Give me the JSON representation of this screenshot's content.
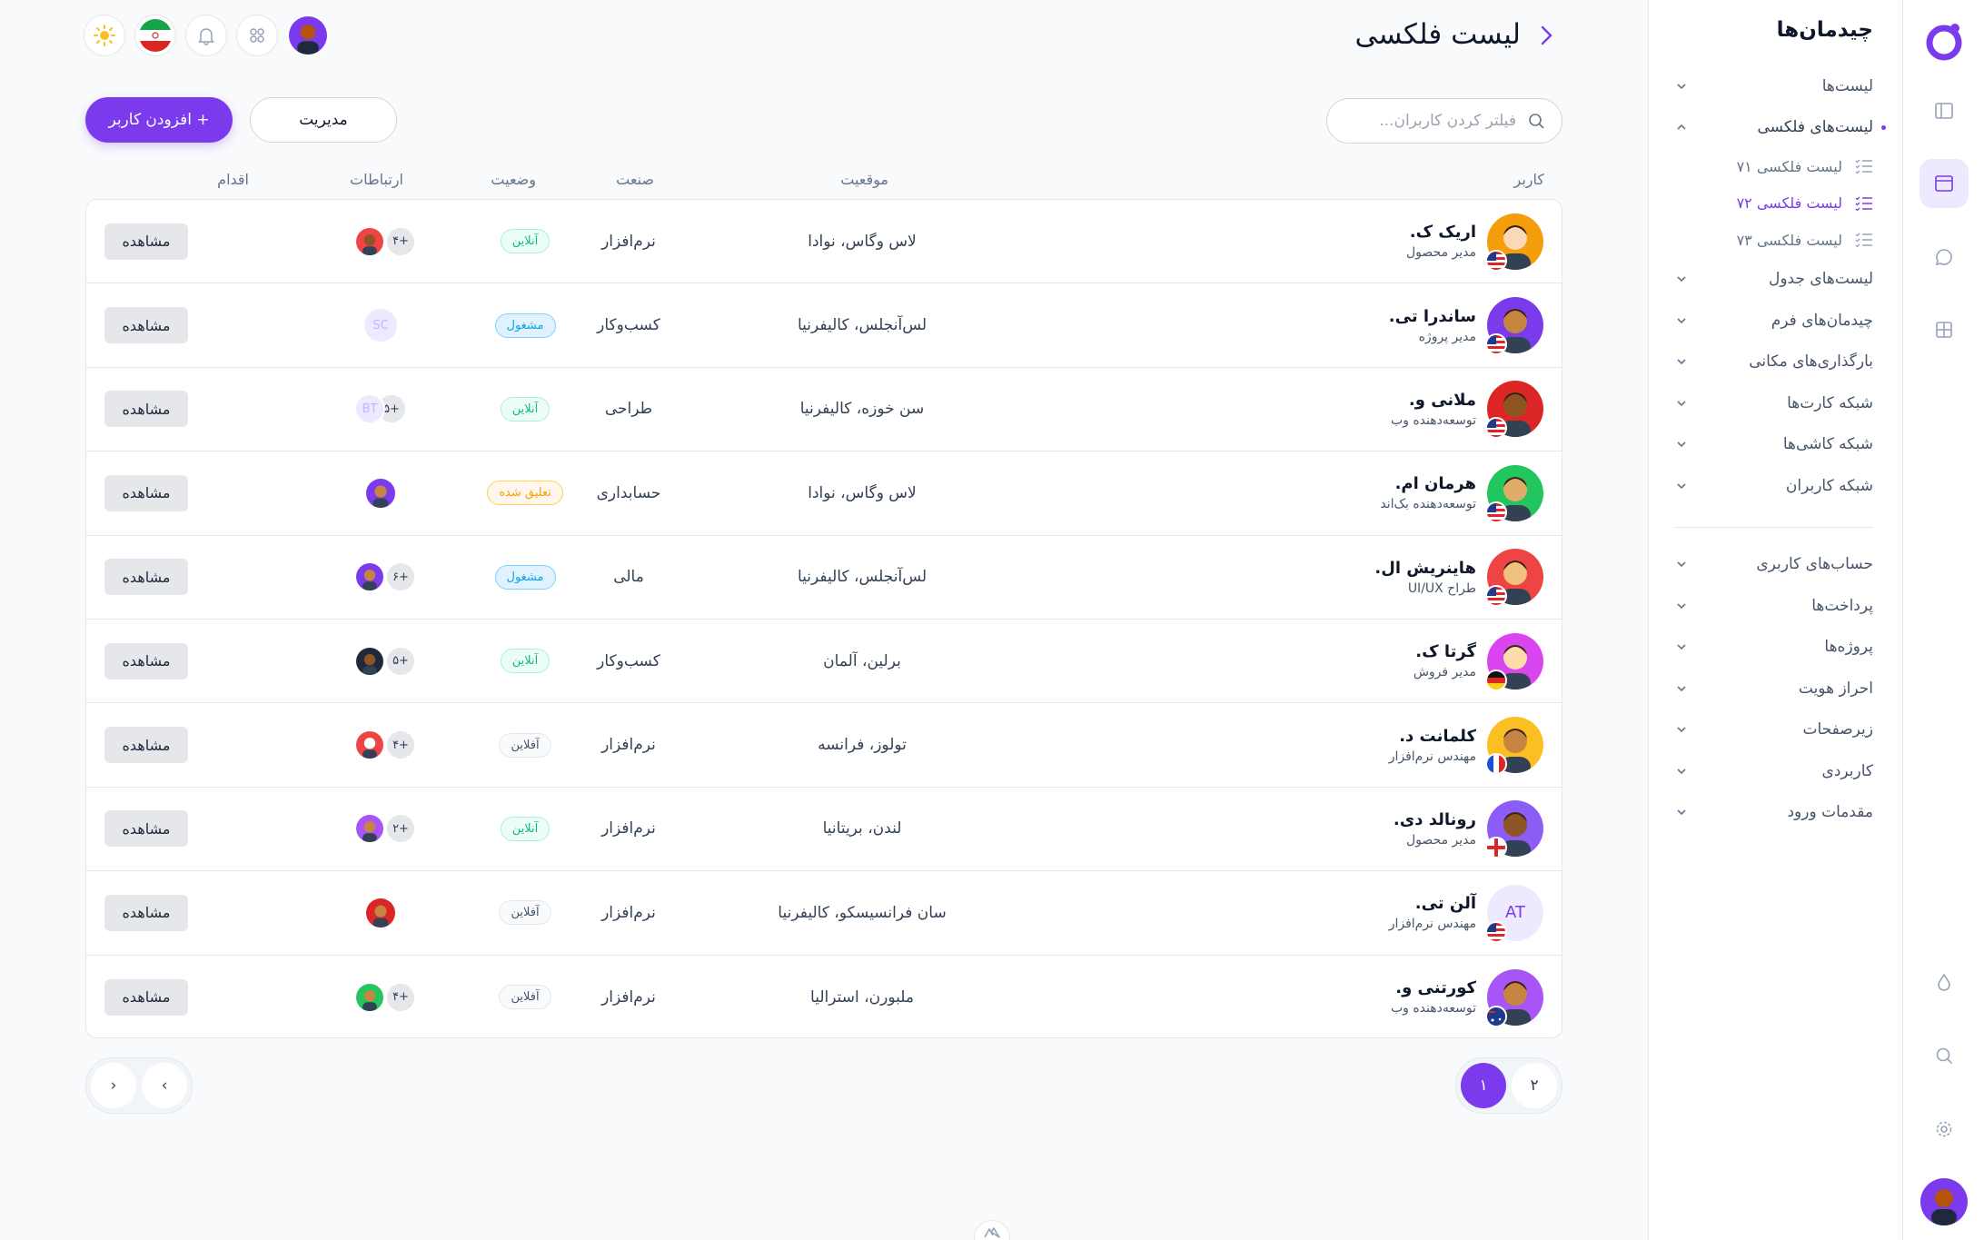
{
  "sidebar": {
    "title": "چیدمان‌ها",
    "items": [
      {
        "label": "لیست‌ها"
      },
      {
        "label": "لیست‌های فلکسی"
      },
      {
        "label": "لیست‌های جدول"
      },
      {
        "label": "چیدمان‌های فرم"
      },
      {
        "label": "بارگذاری‌های مکانی"
      },
      {
        "label": "شبکه کارت‌ها"
      },
      {
        "label": "شبکه کاشی‌ها"
      },
      {
        "label": "شبکه کاربران"
      },
      {
        "label": "حساب‌های کاربری"
      },
      {
        "label": "پرداخت‌ها"
      },
      {
        "label": "پروژه‌ها"
      },
      {
        "label": "احراز هویت"
      },
      {
        "label": "زیرصفحات"
      },
      {
        "label": "کاربردی"
      },
      {
        "label": "مقدمات ورود"
      }
    ],
    "subitems": [
      {
        "label": "لیست فلکسی ۷۱"
      },
      {
        "label": "لیست فلکسی ۷۲"
      },
      {
        "label": "لیست فلکسی ۷۳"
      }
    ]
  },
  "header": {
    "title": "لیست فلکسی"
  },
  "toolbar": {
    "search_placeholder": "فیلتر کردن کاربران...",
    "manage_label": "مدیریت",
    "add_label": "+ افزودن کاربر"
  },
  "columns": {
    "user": "کاربر",
    "location": "موقعیت",
    "industry": "صنعت",
    "status": "وضعیت",
    "relations": "ارتباطات",
    "action": "اقدام"
  },
  "rows": [
    {
      "name": "اریک ک.",
      "role": "مدیر محصول",
      "location": "لاس وگاس، نوادا",
      "industry": "نرم‌افزار",
      "status": "آنلاین",
      "count": "+۴",
      "action": "مشاهده"
    },
    {
      "name": "ساندرا تی.",
      "role": "مدیر پروژه",
      "location": "لس‌آنجلس، کالیفرنیا",
      "industry": "کسب‌وکار",
      "status": "مشغول",
      "initials": "SC",
      "action": "مشاهده"
    },
    {
      "name": "ملانی و.",
      "role": "توسعه‌دهنده وب",
      "location": "سن خوزه، کالیفرنیا",
      "industry": "طراحی",
      "status": "آنلاین",
      "initials": "BT",
      "count": "+۵",
      "action": "مشاهده"
    },
    {
      "name": "هرمان ام.",
      "role": "توسعه‌دهنده بک‌اند",
      "location": "لاس وگاس، نوادا",
      "industry": "حسابداری",
      "status": "تعلیق شده",
      "action": "مشاهده"
    },
    {
      "name": "هاینریش ال.",
      "role": "طراح UI/UX",
      "location": "لس‌آنجلس، کالیفرنیا",
      "industry": "مالی",
      "status": "مشغول",
      "count": "+۶",
      "action": "مشاهده"
    },
    {
      "name": "گرتا ک.",
      "role": "مدیر فروش",
      "location": "برلین، آلمان",
      "industry": "کسب‌وکار",
      "status": "آنلاین",
      "count": "+۵",
      "action": "مشاهده"
    },
    {
      "name": "کلمانت د.",
      "role": "مهندس نرم‌افزار",
      "location": "تولوز، فرانسه",
      "industry": "نرم‌افزار",
      "status": "آفلاین",
      "count": "+۴",
      "action": "مشاهده"
    },
    {
      "name": "رونالد دی.",
      "role": "مدیر محصول",
      "location": "لندن، بریتانیا",
      "industry": "نرم‌افزار",
      "status": "آنلاین",
      "count": "+۲",
      "action": "مشاهده"
    },
    {
      "name": "آلن تی.",
      "role": "مهندس نرم‌افزار",
      "location": "سان فرانسیسکو، کالیفرنیا",
      "industry": "نرم‌افزار",
      "status": "آفلاین",
      "initials": "AT",
      "action": "مشاهده"
    },
    {
      "name": "کورتنی و.",
      "role": "توسعه‌دهنده وب",
      "location": "ملبورن، استرالیا",
      "industry": "نرم‌افزار",
      "status": "آفلاین",
      "count": "+۴",
      "action": "مشاهده"
    }
  ],
  "pagination": {
    "pages": [
      "۱",
      "۲"
    ],
    "current": "۱",
    "prev_label": "‹",
    "next_label": "›"
  },
  "colors": {
    "accent": "#7c3aed",
    "online": "#10b981",
    "busy": "#0ea5e9",
    "suspended": "#f59e0b"
  },
  "icons": [
    "logo-icon",
    "layout-icon",
    "window-icon",
    "chat-icon",
    "grid-icon",
    "drop-icon",
    "search-icon",
    "gear-icon",
    "sun-icon",
    "iran-flag-icon",
    "bell-icon",
    "apps-icon",
    "chevron-left-icon",
    "chevron-down-icon",
    "chevron-up-icon",
    "list-icon"
  ]
}
